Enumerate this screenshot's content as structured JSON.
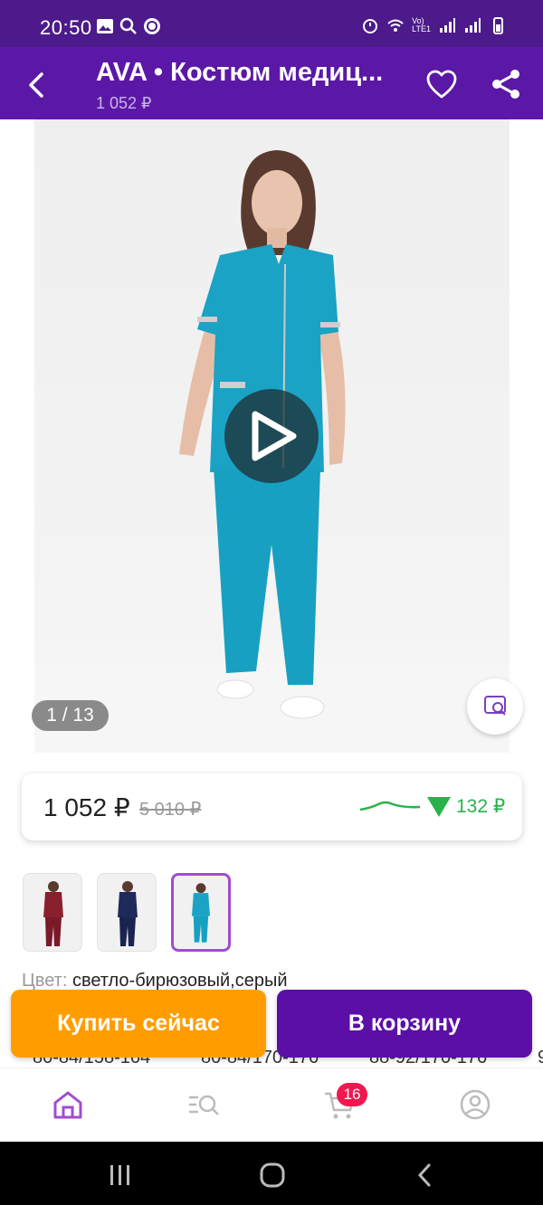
{
  "status_bar": {
    "time": "20:50",
    "network_label": "Vo)\nLTE1"
  },
  "header": {
    "title": "AVA • Костюм медиц...",
    "subtitle": "1 052 ₽"
  },
  "gallery": {
    "counter": "1 / 13"
  },
  "price_card": {
    "price": "1 052 ₽",
    "old_price": "5 010 ₽",
    "drop": "132 ₽",
    "accent": "#2ab24a"
  },
  "thumbnails": [
    {
      "color": "#8a1f2e",
      "selected": false
    },
    {
      "color": "#1f2a5a",
      "selected": false
    },
    {
      "color": "#1aa3c4",
      "selected": true
    }
  ],
  "color": {
    "label": "Цвет:",
    "value": "светло-бирюзовый,серый"
  },
  "sizes_peek": [
    "80-84/158-164",
    "80-84/170-176",
    "88-92/170-176",
    "9"
  ],
  "actions": {
    "buy_now": "Купить сейчас",
    "add_to_cart": "В корзину"
  },
  "bottom_nav": {
    "cart_badge": "16"
  },
  "colors": {
    "brand": "#5b18a6",
    "buy": "#ff9d00",
    "cart": "#5b0fa6"
  }
}
